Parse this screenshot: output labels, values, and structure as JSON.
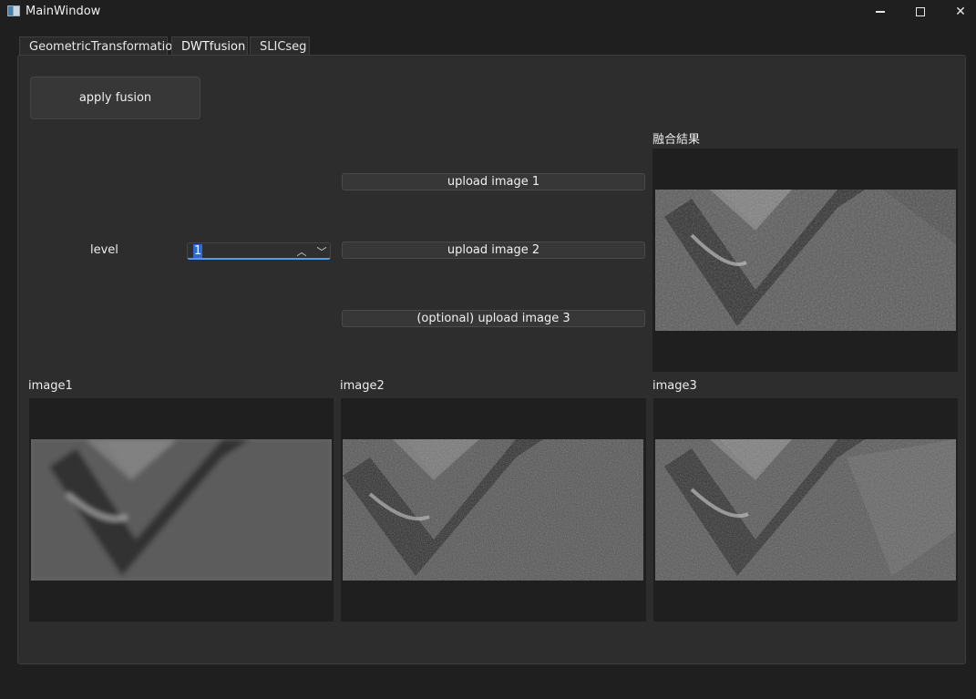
{
  "window": {
    "title": "MainWindow",
    "icon": "app-window-icon"
  },
  "tabs": [
    {
      "label": "GeometricTransformation",
      "active": false
    },
    {
      "label": "DWTfusion",
      "active": true
    },
    {
      "label": "SLICseg",
      "active": false
    }
  ],
  "controls": {
    "apply_label": "apply fusion",
    "level_label": "level",
    "level_value": "1",
    "upload1_label": "upload image 1",
    "upload2_label": "upload image 2",
    "upload3_label": "(optional) upload image 3"
  },
  "images": {
    "fused_title": "融合結果",
    "image1_title": "image1",
    "image2_title": "image2",
    "image3_title": "image3"
  },
  "colors": {
    "accent": "#4f9ee8",
    "selection": "#2f6ad0",
    "panel": "#2d2d2d",
    "background": "#1f1f1f"
  }
}
